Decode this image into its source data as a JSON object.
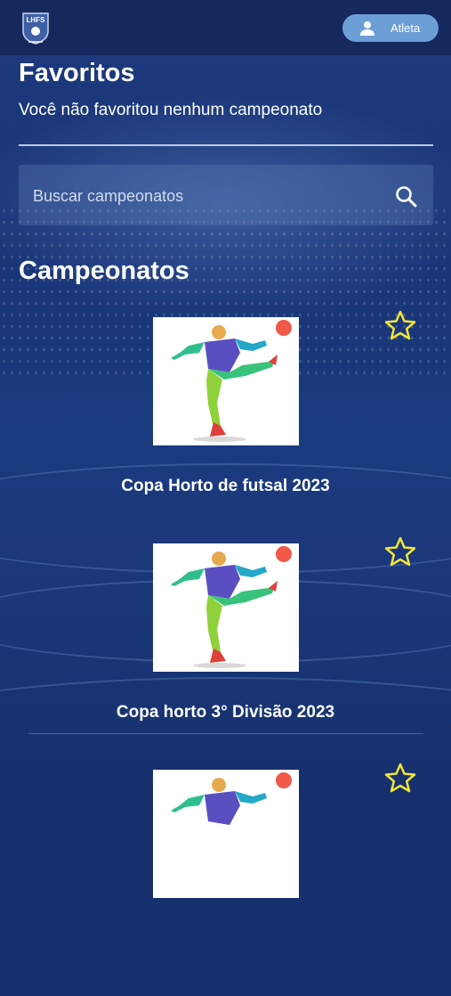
{
  "header": {
    "logo_text": "LHFS",
    "user_button_label": "Atleta",
    "user_icon": "user-icon"
  },
  "favorites": {
    "title": "Favoritos",
    "empty_message": "Você não favoritou nenhum campeonato"
  },
  "search": {
    "placeholder": "Buscar campeonatos",
    "icon": "search-icon"
  },
  "championships": {
    "title": "Campeonatos",
    "items": [
      {
        "name": "Copa Horto de futsal 2023",
        "favorited": false
      },
      {
        "name": "Copa horto 3° Divisão 2023",
        "favorited": false
      },
      {
        "name": "",
        "favorited": false
      }
    ]
  },
  "colors": {
    "background": "#17306e",
    "topbar": "#16295f",
    "user_button": "#6c9fd6",
    "star": "#f2e33a"
  }
}
